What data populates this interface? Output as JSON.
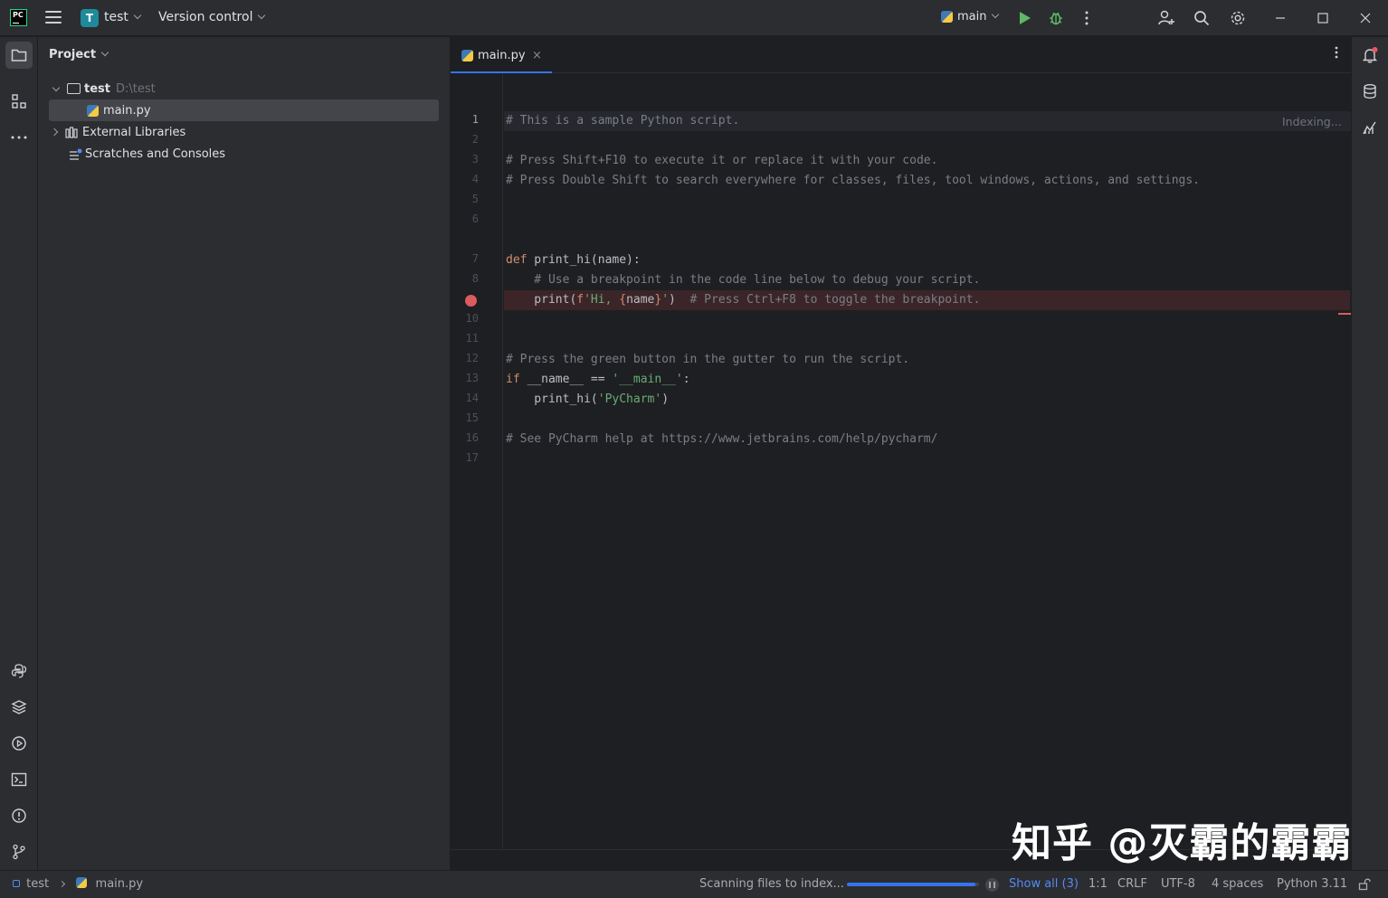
{
  "titlebar": {
    "logo_text": "PC",
    "project_badge": "T",
    "project_name": "test",
    "version_control": "Version control",
    "run_config": "main"
  },
  "project_panel": {
    "title": "Project",
    "tree": {
      "root_name": "test",
      "root_path": "D:\\test",
      "file": "main.py",
      "external_libraries": "External Libraries",
      "scratches": "Scratches and Consoles"
    }
  },
  "editor": {
    "tab_label": "main.py",
    "tab_close": "×",
    "indexing": "Indexing...",
    "line_numbers": [
      "1",
      "2",
      "3",
      "4",
      "5",
      "6",
      "7",
      "8",
      "",
      "10",
      "11",
      "12",
      "13",
      "14",
      "15",
      "16",
      "17"
    ],
    "code": {
      "l1": "# This is a sample Python script.",
      "l3": "# Press Shift+F10 to execute it or replace it with your code.",
      "l4": "# Press Double Shift to search everywhere for classes, files, tool windows, actions, and settings.",
      "l7_kw": "def",
      "l7_rest": " print_hi(name):",
      "l8": "    # Use a breakpoint in the code line below to debug your script.",
      "l9_a": "    print(",
      "l9_f": "f",
      "l9_s1": "'Hi, ",
      "l9_b1": "{",
      "l9_name": "name",
      "l9_b2": "}",
      "l9_s2": "'",
      "l9_c": ")",
      "l9_cmt": "  # Press Ctrl+F8 to toggle the breakpoint.",
      "l12": "# Press the green button in the gutter to run the script.",
      "l13_kw": "if",
      "l13_mid": " __name__ == ",
      "l13_str": "'__main__'",
      "l13_end": ":",
      "l14_a": "    print_hi(",
      "l14_str": "'PyCharm'",
      "l14_end": ")",
      "l16": "# See PyCharm help at https://www.jetbrains.com/help/pycharm/"
    }
  },
  "statusbar": {
    "breadcrumb_project": "test",
    "breadcrumb_file": "main.py",
    "scanning": "Scanning files to index...",
    "progress": 0.97,
    "show_all": "Show all (3)",
    "position": "1:1",
    "line_ending": "CRLF",
    "encoding": "UTF-8",
    "indent": "4 spaces",
    "interpreter": "Python 3.11"
  },
  "watermark": "知乎 @灭霸的霸霸",
  "colors": {
    "accent": "#3574f0",
    "run_green": "#5fb865",
    "breakpoint_red": "#db5c5c",
    "background": "#1e1f22",
    "panel": "#2b2d30"
  },
  "icons": [
    "hamburger-menu-icon",
    "run-icon",
    "debug-icon",
    "more-icon",
    "add-user-icon",
    "search-icon",
    "settings-icon",
    "minimize-icon",
    "maximize-icon",
    "close-icon",
    "project-folder-icon",
    "structure-icon",
    "more-tools-icon",
    "python-console-icon",
    "python-packages-icon",
    "services-icon",
    "terminal-icon",
    "problems-icon",
    "git-icon",
    "notifications-icon",
    "database-icon",
    "profiler-icon"
  ]
}
